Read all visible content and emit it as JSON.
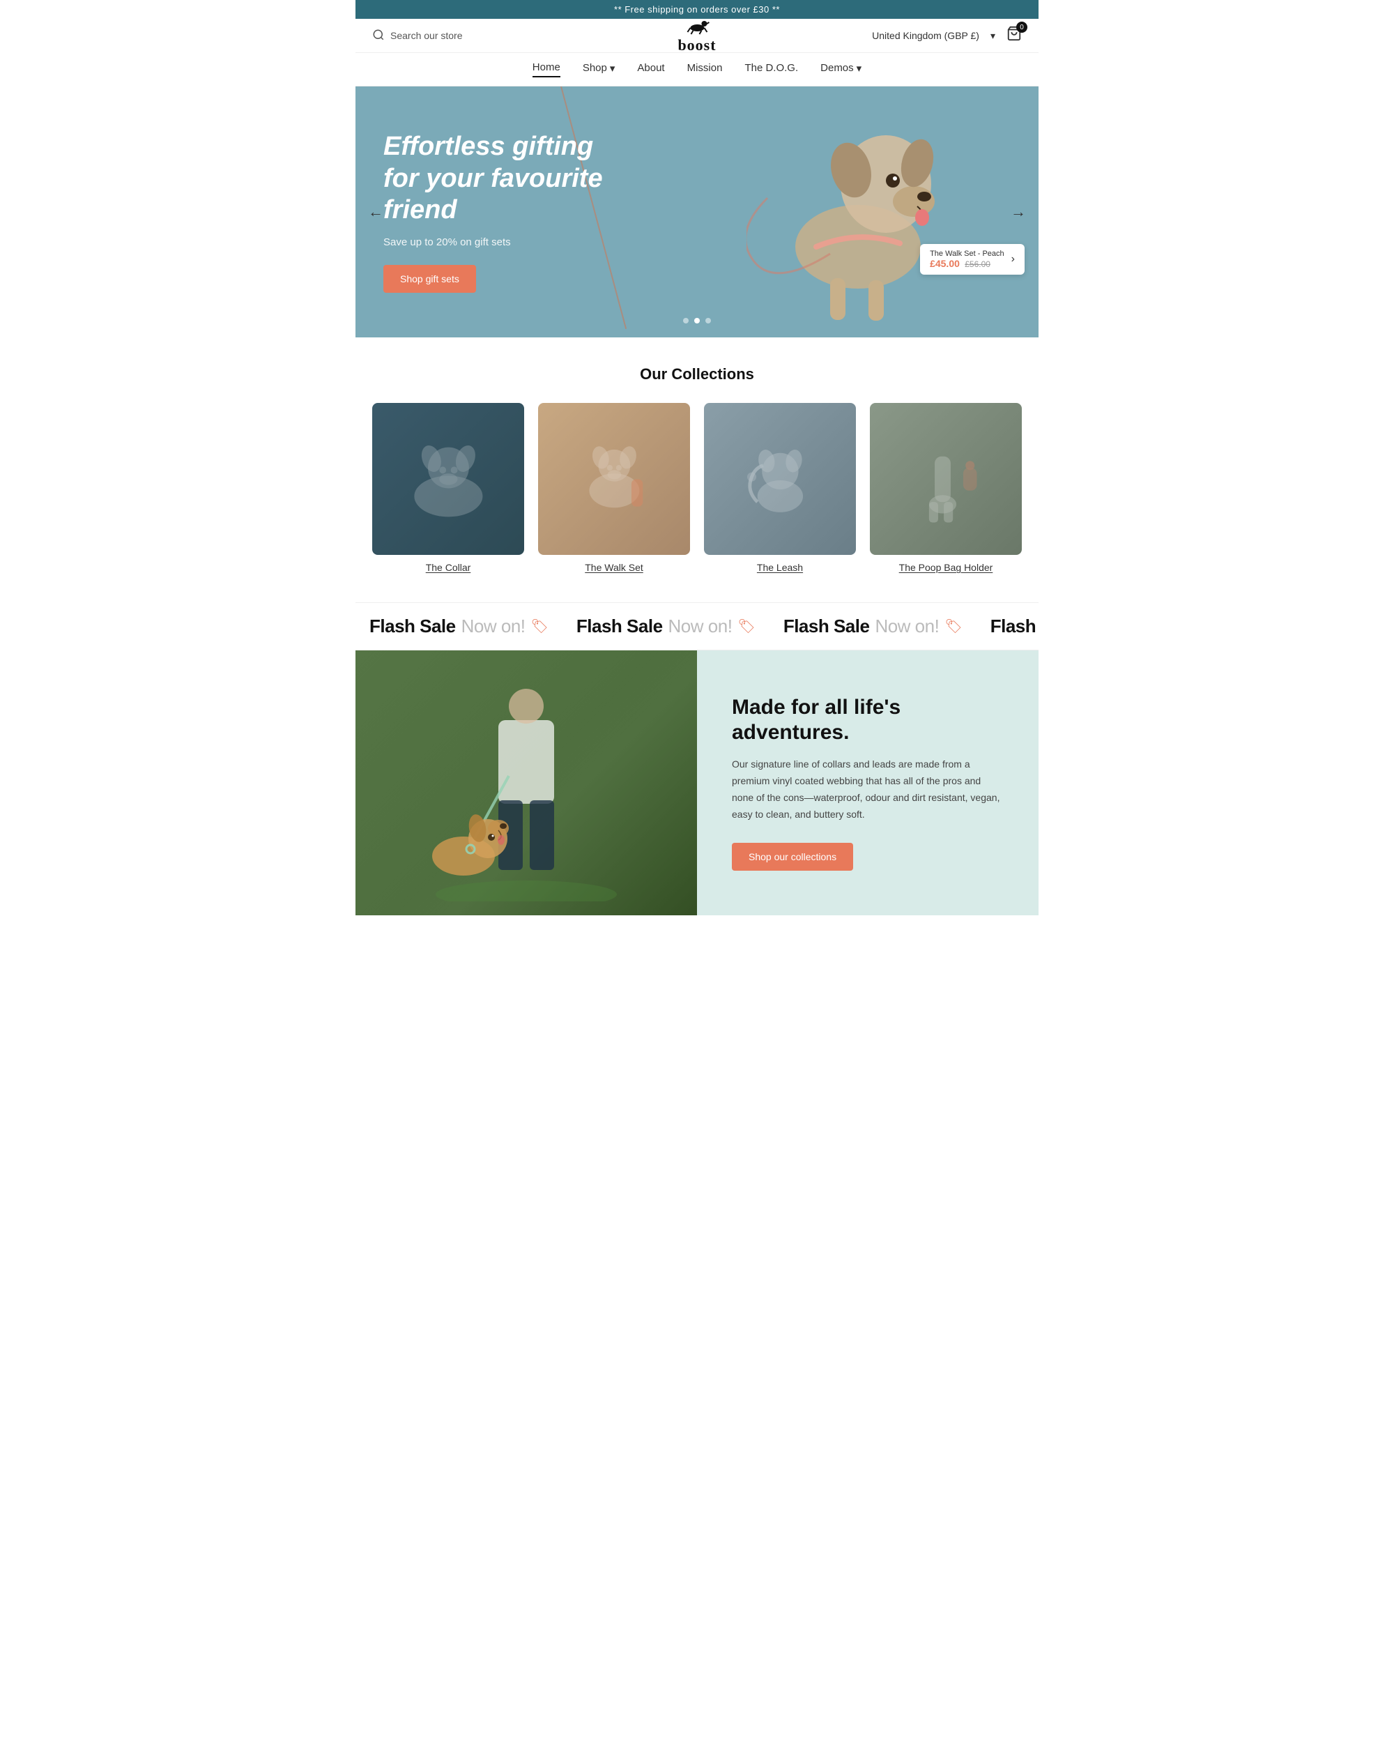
{
  "topBanner": {
    "text": "** Free shipping on orders over £30 **"
  },
  "header": {
    "searchPlaceholder": "Search our store",
    "logoText": "boost",
    "region": "United Kingdom (GBP £)",
    "cartCount": "0"
  },
  "nav": {
    "items": [
      {
        "label": "Home",
        "active": true,
        "hasDropdown": false
      },
      {
        "label": "Shop",
        "active": false,
        "hasDropdown": true
      },
      {
        "label": "About",
        "active": false,
        "hasDropdown": false
      },
      {
        "label": "Mission",
        "active": false,
        "hasDropdown": false
      },
      {
        "label": "The D.O.G.",
        "active": false,
        "hasDropdown": false
      },
      {
        "label": "Demos",
        "active": false,
        "hasDropdown": true
      }
    ]
  },
  "hero": {
    "title": "Effortless gifting for your favourite friend",
    "subtitle": "Save up to 20% on gift sets",
    "buttonLabel": "Shop gift sets",
    "productTag": {
      "name": "The Walk Set - Peach",
      "priceNew": "£45.00",
      "priceOld": "£56.00"
    },
    "dots": [
      1,
      2,
      3
    ],
    "activeDot": 1
  },
  "collections": {
    "title": "Our Collections",
    "items": [
      {
        "label": "The Collar",
        "colorClass": "collar",
        "emoji": "🐕"
      },
      {
        "label": "The Walk Set",
        "colorClass": "walk",
        "emoji": "🦮"
      },
      {
        "label": "The Leash",
        "colorClass": "leash",
        "emoji": "🐩"
      },
      {
        "label": "The Poop Bag Holder",
        "colorClass": "poop",
        "emoji": "🛍️"
      }
    ]
  },
  "flashSale": {
    "boldText": "Flash Sale",
    "lightText": "Now on!",
    "repeatCount": 6
  },
  "feature": {
    "title": "Made for all life's adventures.",
    "description": "Our signature line of collars and leads are made from a premium vinyl coated webbing that has all of the pros and none of the cons—waterproof, odour and dirt resistant, vegan, easy to clean, and buttery soft.",
    "buttonLabel": "Shop our collections"
  }
}
